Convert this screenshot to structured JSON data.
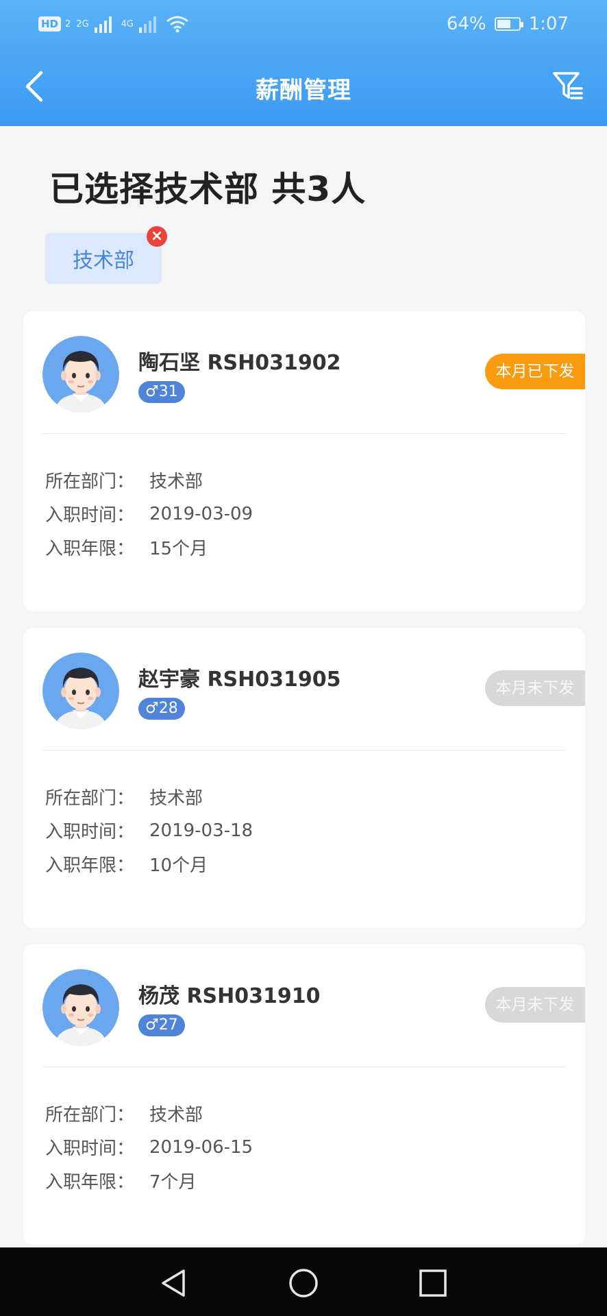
{
  "status_bar": {
    "hd_label": "HD",
    "sim1": "2",
    "net1": "2G",
    "net2": "4G",
    "battery_text": "64%",
    "battery_level": 0.64,
    "time": "1:07"
  },
  "nav": {
    "title": "薪酬管理",
    "back_icon": "chevron-left-icon",
    "filter_icon": "filter-icon"
  },
  "summary": {
    "title": "已选择技术部  共3人",
    "chip_label": "技术部"
  },
  "labels": {
    "department": "所在部门：",
    "hire_date": "入职时间：",
    "tenure": "入职年限："
  },
  "employees": [
    {
      "name": "陶石坚 RSH031902",
      "age_badge": "♂31",
      "status": "本月已下发",
      "department": "技术部",
      "hire_date": "2019-03-09",
      "tenure": "15个月"
    },
    {
      "name": "赵宇豪 RSH031905",
      "age_badge": "♂28",
      "status": "本月未下发",
      "department": "技术部",
      "hire_date": "2019-03-18",
      "tenure": "10个月"
    },
    {
      "name": "杨茂 RSH031910",
      "age_badge": "♂27",
      "status": "本月未下发",
      "department": "技术部",
      "hire_date": "2019-06-15",
      "tenure": "7个月"
    }
  ],
  "colors": {
    "header": "#3b9bf2",
    "paid": "#f99a0f",
    "unpaid": "#d8d8d8",
    "badge": "#4f84d8"
  }
}
